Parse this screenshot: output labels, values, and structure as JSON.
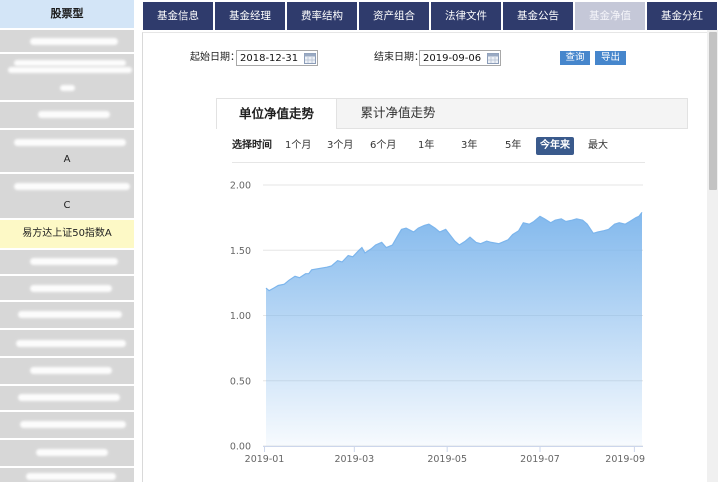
{
  "sidebar": {
    "header": "股票型",
    "items": [
      {
        "text": ""
      },
      {
        "text": ""
      },
      {
        "text": ""
      },
      {
        "text": "A"
      },
      {
        "text": "C"
      },
      {
        "text": "易方达上证50指数A",
        "selected": true
      },
      {
        "text": ""
      },
      {
        "text": ""
      },
      {
        "text": ""
      },
      {
        "text": ""
      },
      {
        "text": ""
      },
      {
        "text": ""
      },
      {
        "text": ""
      },
      {
        "text": ""
      },
      {
        "text": ""
      }
    ]
  },
  "nav": {
    "tabs": [
      "基金信息",
      "基金经理",
      "费率结构",
      "资产组合",
      "法律文件",
      "基金公告",
      "基金净值",
      "基金分红"
    ],
    "active": "基金净值"
  },
  "query": {
    "start_label": "起始日期：",
    "start_value": "2018-12-31",
    "end_label": "结束日期：",
    "end_value": "2019-09-06",
    "query_button": "查询",
    "export_button": "导出",
    "date_icon": "calendar-icon"
  },
  "chart_panel": {
    "tabs": [
      "单位净值走势",
      "累计净值走势"
    ],
    "active": "单位净值走势"
  },
  "range_selector": {
    "label": "选择时间",
    "options": [
      "1个月",
      "3个月",
      "6个月",
      "1年",
      "3年",
      "5年",
      "今年来",
      "最大"
    ],
    "active": "今年来"
  },
  "colors": {
    "nav_bg": "#2f3b6c",
    "nav_active": "#c5c8d8",
    "sidebar_header": "#d3e5f7",
    "sidebar_item": "#d7d7d7",
    "sidebar_selected": "#fdf9c6",
    "button": "#4686cc",
    "range_active": "#3a5a8c",
    "series": "#7cb5ec"
  },
  "chart_data": {
    "type": "area",
    "xlim": [
      "2018-12-31",
      "2019-09-06"
    ],
    "ylim": [
      0,
      2
    ],
    "yticks": [
      "0.00",
      "0.50",
      "1.00",
      "1.50",
      "2.00"
    ],
    "xticks": [
      "2019-01",
      "2019-03",
      "2019-05",
      "2019-07",
      "2019-09"
    ],
    "grid": true,
    "legend": "none",
    "x": [
      "2019-01-02",
      "2019-01-04",
      "2019-01-07",
      "2019-01-10",
      "2019-01-14",
      "2019-01-17",
      "2019-01-21",
      "2019-01-24",
      "2019-01-28",
      "2019-01-30",
      "2019-02-01",
      "2019-02-11",
      "2019-02-14",
      "2019-02-18",
      "2019-02-21",
      "2019-02-25",
      "2019-02-28",
      "2019-03-04",
      "2019-03-06",
      "2019-03-08",
      "2019-03-12",
      "2019-03-15",
      "2019-03-19",
      "2019-03-22",
      "2019-03-26",
      "2019-03-29",
      "2019-04-01",
      "2019-04-04",
      "2019-04-09",
      "2019-04-12",
      "2019-04-16",
      "2019-04-19",
      "2019-04-23",
      "2019-04-26",
      "2019-04-30",
      "2019-05-06",
      "2019-05-09",
      "2019-05-13",
      "2019-05-16",
      "2019-05-20",
      "2019-05-23",
      "2019-05-27",
      "2019-05-30",
      "2019-06-04",
      "2019-06-10",
      "2019-06-13",
      "2019-06-17",
      "2019-06-20",
      "2019-06-24",
      "2019-06-27",
      "2019-07-01",
      "2019-07-04",
      "2019-07-08",
      "2019-07-11",
      "2019-07-15",
      "2019-07-18",
      "2019-07-22",
      "2019-07-25",
      "2019-07-29",
      "2019-08-01",
      "2019-08-05",
      "2019-08-08",
      "2019-08-12",
      "2019-08-15",
      "2019-08-19",
      "2019-08-22",
      "2019-08-26",
      "2019-08-29",
      "2019-09-02",
      "2019-09-04",
      "2019-09-06"
    ],
    "values": [
      1.21,
      1.19,
      1.21,
      1.23,
      1.24,
      1.27,
      1.3,
      1.29,
      1.32,
      1.32,
      1.35,
      1.37,
      1.38,
      1.42,
      1.41,
      1.46,
      1.45,
      1.5,
      1.52,
      1.48,
      1.51,
      1.54,
      1.56,
      1.52,
      1.54,
      1.6,
      1.66,
      1.67,
      1.64,
      1.67,
      1.69,
      1.7,
      1.67,
      1.64,
      1.66,
      1.57,
      1.54,
      1.57,
      1.6,
      1.56,
      1.55,
      1.57,
      1.56,
      1.55,
      1.58,
      1.62,
      1.65,
      1.71,
      1.7,
      1.72,
      1.76,
      1.74,
      1.71,
      1.73,
      1.74,
      1.72,
      1.73,
      1.74,
      1.73,
      1.7,
      1.63,
      1.64,
      1.65,
      1.66,
      1.7,
      1.71,
      1.7,
      1.72,
      1.75,
      1.76,
      1.79
    ]
  }
}
